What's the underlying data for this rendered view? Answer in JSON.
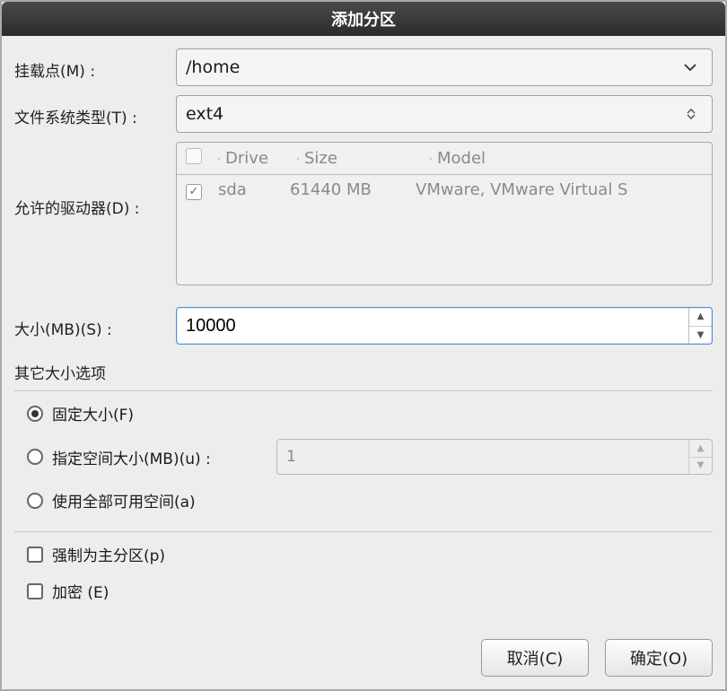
{
  "window": {
    "title": "添加分区"
  },
  "labels": {
    "mount_point": "挂载点(M) :",
    "fs_type": "文件系统类型(T) :",
    "allowed_drives": "允许的驱动器(D) :",
    "size": "大小(MB)(S) :",
    "additional_size": "其它大小选项",
    "fixed_size": "固定大小(F)",
    "fill_to": "指定空间大小(MB)(u) :",
    "fill_all": "使用全部可用空间(a)",
    "force_primary": "强制为主分区(p)",
    "encrypt": "加密 (E)"
  },
  "fields": {
    "mount_point": "/home",
    "fs_type": "ext4",
    "size": "10000",
    "fill_to_value": "1"
  },
  "drives": {
    "headers": {
      "check": "O",
      "drive": "Drive",
      "size": "Size",
      "model": "Model"
    },
    "rows": [
      {
        "checked": true,
        "drive": "sda",
        "size": "61440 MB",
        "model": "VMware, VMware Virtual S"
      }
    ]
  },
  "buttons": {
    "cancel": "取消(C)",
    "ok": "确定(O)"
  }
}
